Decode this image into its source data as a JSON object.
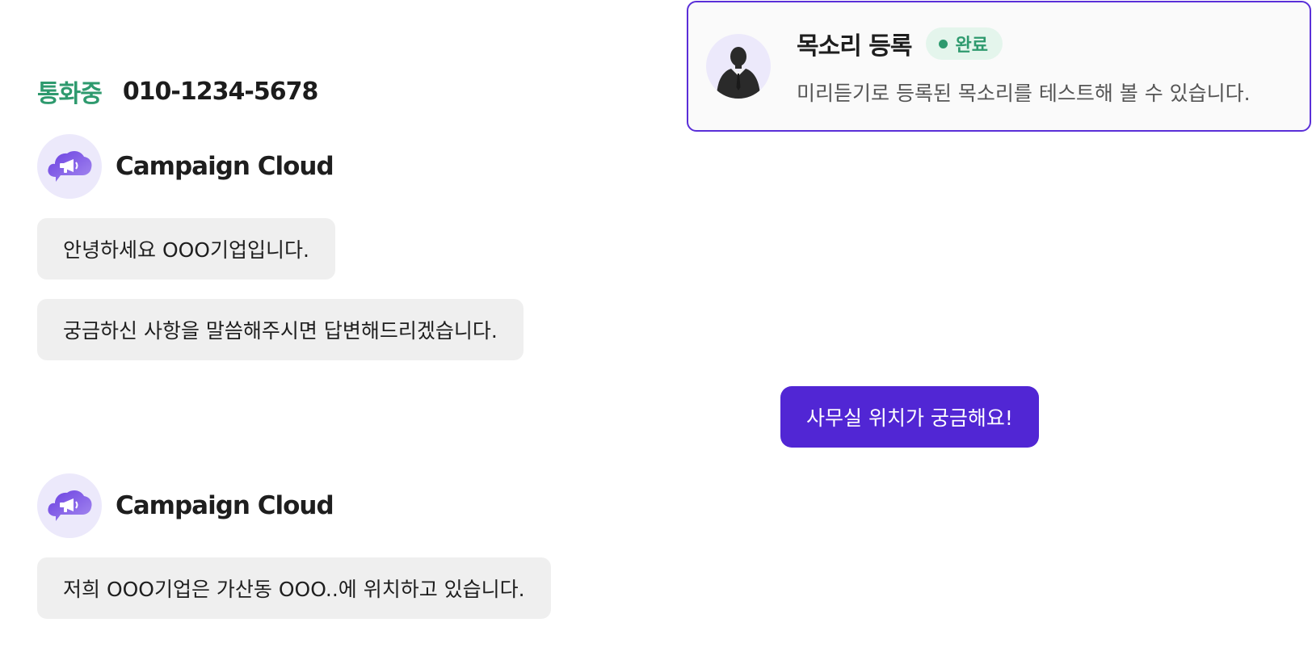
{
  "call": {
    "status": "통화중",
    "number": "010-1234-5678"
  },
  "voice_card": {
    "title": "목소리 등록",
    "badge": "완료",
    "description": "미리듣기로 등록된 목소리를 테스트해 볼 수 있습니다.",
    "avatar_icon": "businessman-silhouette-icon"
  },
  "messages": {
    "sender_1": {
      "name": "Campaign Cloud",
      "icon": "megaphone-cloud-icon"
    },
    "bubble_1": "안녕하세요 OOO기업입니다.",
    "bubble_2": "궁금하신 사항을 말씀해주시면 답변해드리겠습니다.",
    "user_bubble": "사무실 위치가 궁금해요!",
    "sender_2": {
      "name": "Campaign Cloud",
      "icon": "megaphone-cloud-icon"
    },
    "bubble_3": "저희 OOO기업은 가산동 OOO..에 위치하고 있습니다."
  },
  "colors": {
    "accent": "#5126d4",
    "status_green": "#2e9a6e",
    "bubble_gray": "#efefef",
    "avatar_bg": "#ece9fb"
  }
}
